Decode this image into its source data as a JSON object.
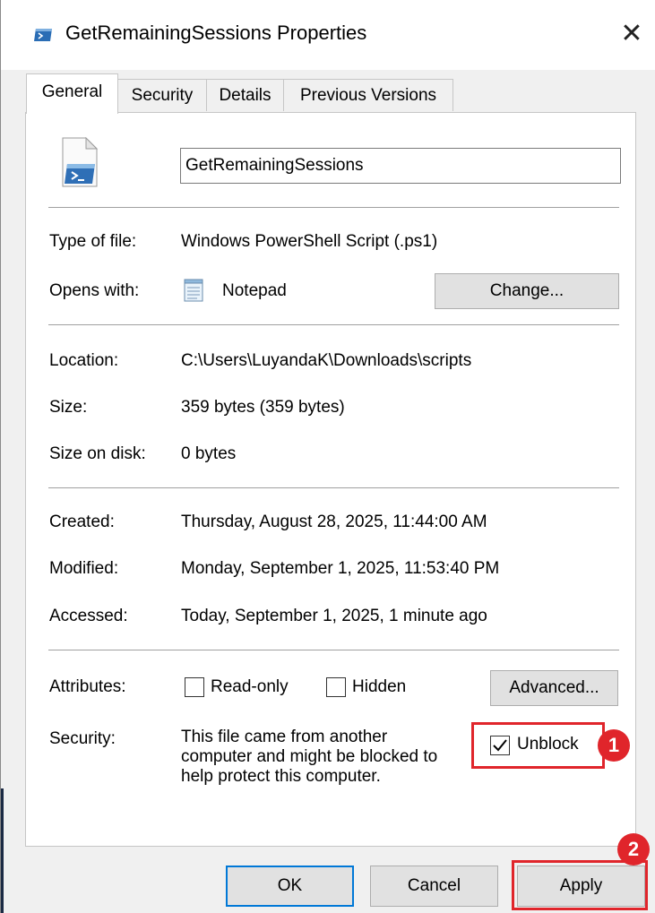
{
  "window": {
    "title": "GetRemainingSessions Properties",
    "close_glyph": "✕"
  },
  "tabs": [
    {
      "label": "General",
      "active": true
    },
    {
      "label": "Security",
      "active": false
    },
    {
      "label": "Details",
      "active": false
    },
    {
      "label": "Previous Versions",
      "active": false
    }
  ],
  "general": {
    "file_name": "GetRemainingSessions",
    "file_icon": "powershell-script-icon",
    "type_label": "Type of file:",
    "type_value": "Windows PowerShell Script (.ps1)",
    "opens_label": "Opens with:",
    "opens_value": "Notepad",
    "opens_icon": "notepad-icon",
    "change_button": "Change...",
    "location_label": "Location:",
    "location_value": "C:\\Users\\LuyandaK\\Downloads\\scripts",
    "size_label": "Size:",
    "size_value": "359 bytes (359 bytes)",
    "size_on_disk_label": "Size on disk:",
    "size_on_disk_value": "0 bytes",
    "created_label": "Created:",
    "created_value": "Thursday, August 28, 2025, 11:44:00 AM",
    "modified_label": "Modified:",
    "modified_value": "Monday, September 1, 2025, 11:53:40 PM",
    "accessed_label": "Accessed:",
    "accessed_value": "Today, September 1, 2025, 1 minute ago",
    "attributes_label": "Attributes:",
    "readonly_label": "Read-only",
    "readonly_checked": false,
    "hidden_label": "Hidden",
    "hidden_checked": false,
    "advanced_button": "Advanced...",
    "security_label": "Security:",
    "security_text_1": "This file came from another",
    "security_text_2": "computer and might be blocked to",
    "security_text_3": "help protect this computer.",
    "unblock_label": "Unblock",
    "unblock_checked": true
  },
  "annotations": {
    "badge_1": "1",
    "badge_2": "2",
    "highlight_color": "#e0252b"
  },
  "footer": {
    "ok_button": "OK",
    "cancel_button": "Cancel",
    "apply_button": "Apply"
  }
}
